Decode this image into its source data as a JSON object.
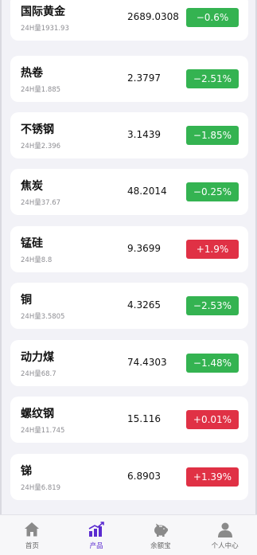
{
  "products": [
    {
      "name": "国际黄金",
      "volume": "24H量1931.93",
      "price": "2689.0308",
      "change": "−0.6%",
      "direction": "down"
    },
    {
      "name": "热卷",
      "volume": "24H量1.885",
      "price": "2.3797",
      "change": "−2.51%",
      "direction": "down"
    },
    {
      "name": "不锈钢",
      "volume": "24H量2.396",
      "price": "3.1439",
      "change": "−1.85%",
      "direction": "down"
    },
    {
      "name": "焦炭",
      "volume": "24H量37.67",
      "price": "48.2014",
      "change": "−0.25%",
      "direction": "down"
    },
    {
      "name": "锰硅",
      "volume": "24H量8.8",
      "price": "9.3699",
      "change": "+1.9%",
      "direction": "up"
    },
    {
      "name": "铜",
      "volume": "24H量3.5805",
      "price": "4.3265",
      "change": "−2.53%",
      "direction": "down"
    },
    {
      "name": "动力煤",
      "volume": "24H量68.7",
      "price": "74.4303",
      "change": "−1.48%",
      "direction": "down"
    },
    {
      "name": "螺纹钢",
      "volume": "24H量11.745",
      "price": "15.116",
      "change": "+0.01%",
      "direction": "up"
    },
    {
      "name": "锑",
      "volume": "24H量6.819",
      "price": "6.8903",
      "change": "+1.39%",
      "direction": "up"
    }
  ],
  "colors": {
    "down": "#34b351",
    "up": "#e03145",
    "active_tab": "#5b2bd0",
    "inactive_icon": "#8a8a8a"
  },
  "tabbar": {
    "tabs": [
      {
        "label": "首页",
        "icon": "home-icon",
        "active": false
      },
      {
        "label": "产品",
        "icon": "bar-chart-icon",
        "active": true
      },
      {
        "label": "余额宝",
        "icon": "piggy-bank-icon",
        "active": false
      },
      {
        "label": "个人中心",
        "icon": "person-icon",
        "active": false
      }
    ]
  }
}
